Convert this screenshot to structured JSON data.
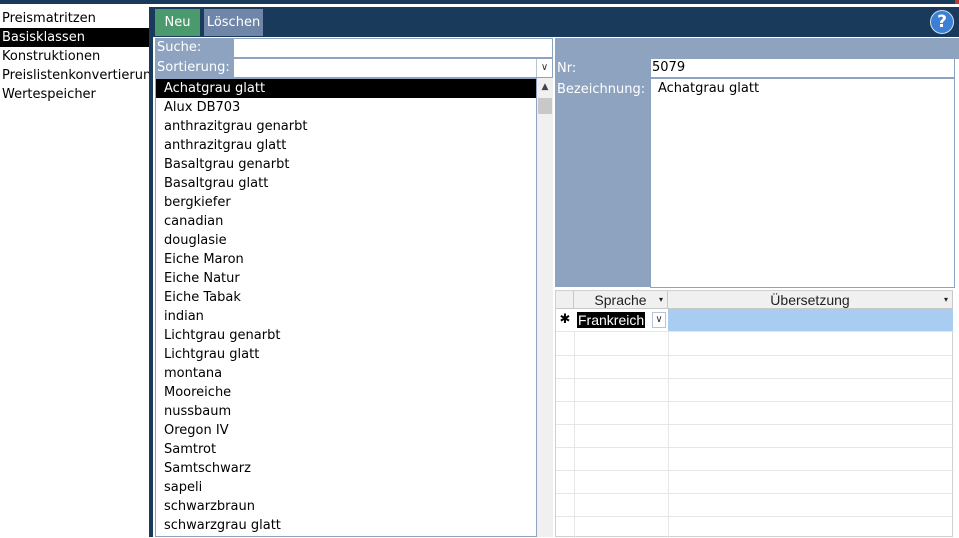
{
  "nav": {
    "items": [
      {
        "label": "Preismatritzen",
        "selected": false
      },
      {
        "label": "Basisklassen",
        "selected": true
      },
      {
        "label": "Konstruktionen",
        "selected": false
      },
      {
        "label": "Preislistenkonvertierung",
        "selected": false
      },
      {
        "label": "Wertespeicher",
        "selected": false
      }
    ]
  },
  "toolbar": {
    "new_label": "Neu",
    "delete_label": "Löschen",
    "help_label": "?"
  },
  "search": {
    "label": "Suche:",
    "value": ""
  },
  "sort": {
    "label": "Sortierung:",
    "value": ""
  },
  "list": {
    "items": [
      "Achatgrau glatt",
      "Alux DB703",
      "anthrazitgrau genarbt",
      "anthrazitgrau glatt",
      "Basaltgrau genarbt",
      "Basaltgrau glatt",
      "bergkiefer",
      "canadian",
      "douglasie",
      "Eiche Maron",
      "Eiche Natur",
      "Eiche Tabak",
      "indian",
      "Lichtgrau genarbt",
      "Lichtgrau glatt",
      "montana",
      "Mooreiche",
      "nussbaum",
      "Oregon IV",
      "Samtrot",
      "Samtschwarz",
      "sapeli",
      "schwarzbraun",
      "schwarzgrau glatt"
    ],
    "selected_index": 0
  },
  "detail": {
    "nr_label": "Nr:",
    "nr_value": "5079",
    "bezeichnung_label": "Bezeichnung:",
    "bezeichnung_value": "Achatgrau glatt"
  },
  "grid": {
    "col_sprache": "Sprache",
    "col_uebersetzung": "Übersetzung",
    "new_row_marker": "✱",
    "new_row_sprache": "Frankreich",
    "new_row_uebersetzung": ""
  },
  "colors": {
    "navy": "#1a3a5c",
    "label_blue": "#8da3bf",
    "new_button": "#4a9a6e",
    "delete_button": "#6f86a8",
    "grid_highlight": "#a9cdf0"
  }
}
